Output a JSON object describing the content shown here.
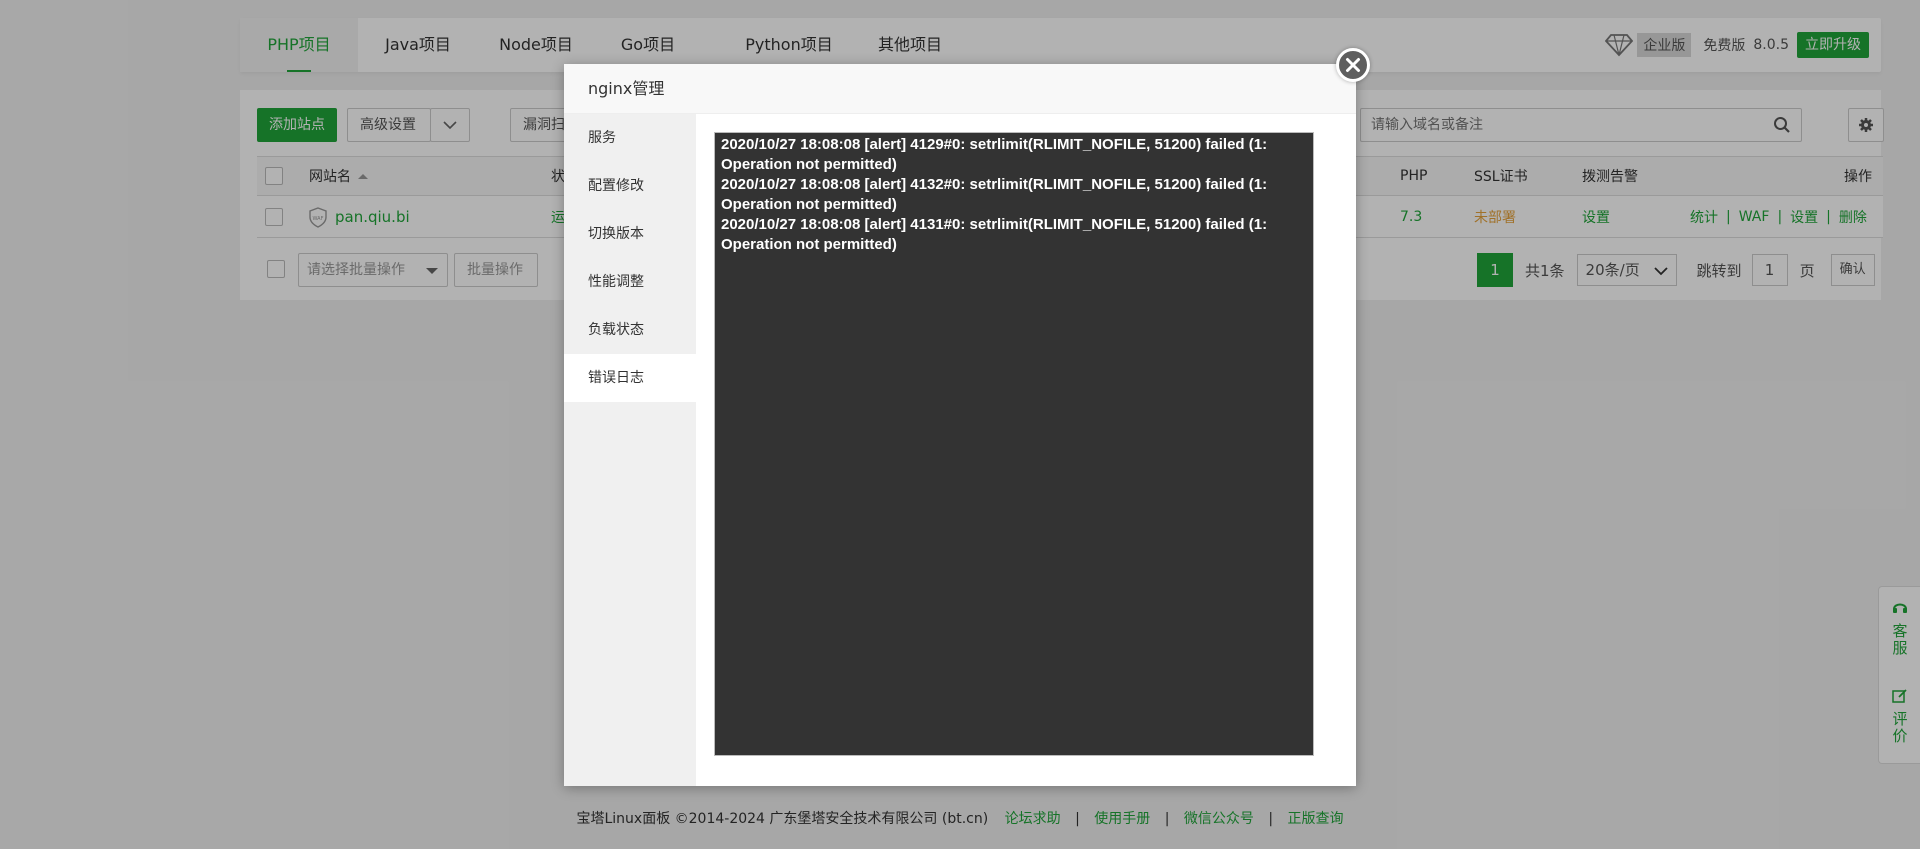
{
  "project_tabs": [
    {
      "label": "PHP项目",
      "active": true
    },
    {
      "label": "Java项目",
      "active": false
    },
    {
      "label": "Node项目",
      "active": false
    },
    {
      "label": "Go项目",
      "active": false
    },
    {
      "label": "Python项目",
      "active": false
    },
    {
      "label": "其他项目",
      "active": false
    }
  ],
  "version": {
    "enterprise_label": "企业版",
    "free_label": "免费版",
    "version_number": "8.0.5",
    "upgrade_label": "立即升级"
  },
  "toolbar": {
    "add_site_label": "添加站点",
    "advanced_settings_label": "高级设置",
    "vuln_scan_label": "漏洞扫",
    "search_placeholder": "请输入域名或备注"
  },
  "table": {
    "headers": {
      "site_name": "网站名",
      "status": "状",
      "php": "PHP",
      "ssl": "SSL证书",
      "monitor": "拨测告警",
      "actions": "操作"
    },
    "rows": [
      {
        "site_name": "pan.qiu.bi",
        "status": "运",
        "php": "7.3",
        "ssl": "未部署",
        "monitor": "设置",
        "actions": [
          "统计",
          "WAF",
          "设置",
          "删除"
        ]
      }
    ]
  },
  "batch": {
    "select_placeholder": "请选择批量操作",
    "batch_button_label": "批量操作"
  },
  "pagination": {
    "current_page": "1",
    "total_label": "共1条",
    "per_page_label": "20条/页",
    "goto_label": "跳转到",
    "goto_value": "1",
    "page_suffix": "页",
    "confirm_label": "确认"
  },
  "footer": {
    "copyright": "宝塔Linux面板 ©2014-2024 广东堡塔安全技术有限公司 (bt.cn)",
    "links": [
      "论坛求助",
      "使用手册",
      "微信公众号",
      "正版查询"
    ]
  },
  "side_float": {
    "service_label": "客服",
    "review_label": "评价"
  },
  "modal": {
    "title": "nginx管理",
    "menu": [
      {
        "label": "服务",
        "active": false
      },
      {
        "label": "配置修改",
        "active": false
      },
      {
        "label": "切换版本",
        "active": false
      },
      {
        "label": "性能调整",
        "active": false
      },
      {
        "label": "负载状态",
        "active": false
      },
      {
        "label": "错误日志",
        "active": true
      }
    ],
    "log_lines": [
      "2020/10/27 18:08:08 [alert] 4129#0: setrlimit(RLIMIT_NOFILE, 51200) failed (1: Operation not permitted)",
      "2020/10/27 18:08:08 [alert] 4132#0: setrlimit(RLIMIT_NOFILE, 51200) failed (1: Operation not permitted)",
      "2020/10/27 18:08:08 [alert] 4131#0: setrlimit(RLIMIT_NOFILE, 51200) failed (1: Operation not permitted)"
    ]
  },
  "colors": {
    "accent": "#20a53a",
    "warning": "#e6a23c",
    "log_bg": "#333333",
    "icons": [
      "diamond-icon",
      "shield-icon",
      "search-icon",
      "gear-icon",
      "chevron-down-icon",
      "close-icon",
      "headset-icon",
      "edit-icon"
    ]
  }
}
